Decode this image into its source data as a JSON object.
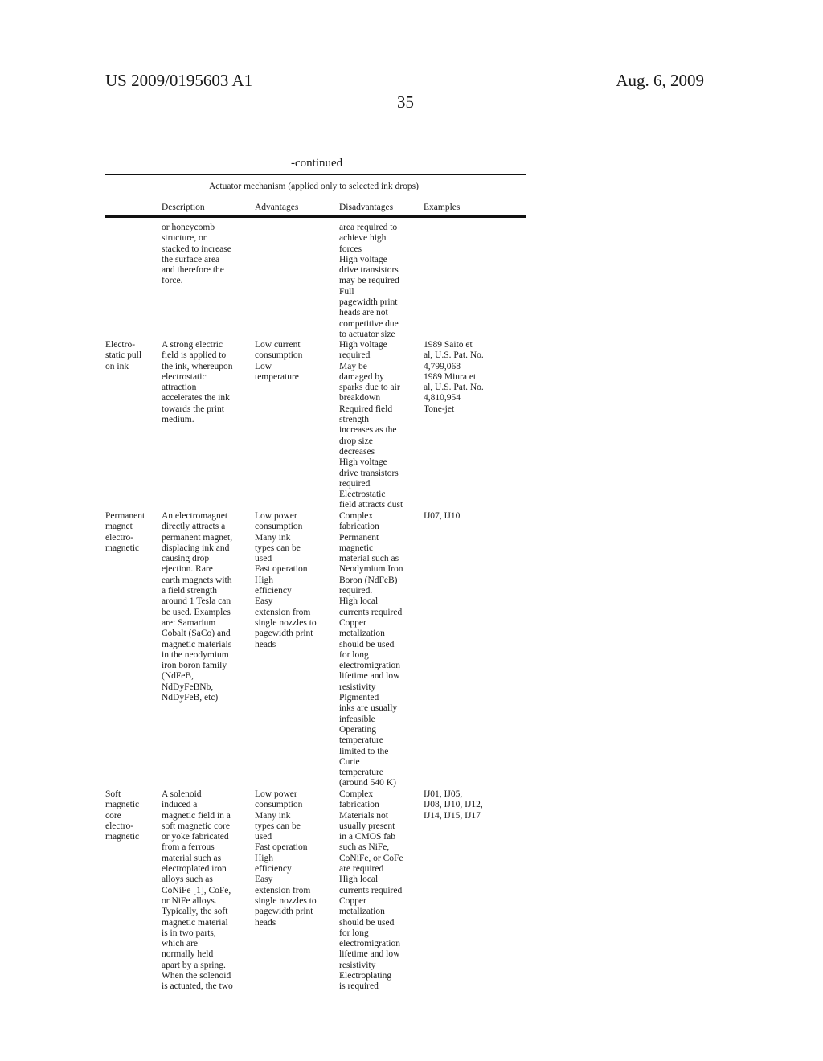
{
  "header": {
    "publication_number": "US 2009/0195603 A1",
    "date": "Aug. 6, 2009",
    "page_number": "35"
  },
  "table": {
    "continued_label": "-continued",
    "caption": "Actuator mechanism (applied only to selected ink drops)",
    "columns": [
      "",
      "Description",
      "Advantages",
      "Disadvantages",
      "Examples"
    ],
    "rows": [
      {
        "name": "",
        "description": "or honeycomb\nstructure, or\nstacked to increase\nthe surface area\nand therefore the\nforce.",
        "advantages": "",
        "disadvantages": "area required to\nachieve high\nforces\nHigh voltage\ndrive transistors\nmay be required\nFull\npagewidth print\nheads are not\ncompetitive due\nto actuator size",
        "examples": ""
      },
      {
        "name": "Electro-\nstatic pull\non ink",
        "description": "A strong electric\nfield is applied to\nthe ink, whereupon\nelectrostatic\nattraction\naccelerates the ink\ntowards the print\nmedium.",
        "advantages": "Low current\nconsumption\nLow\ntemperature",
        "disadvantages": "High voltage\nrequired\nMay be\ndamaged by\nsparks due to air\nbreakdown\nRequired field\nstrength\nincreases as the\ndrop size\ndecreases\nHigh voltage\ndrive transistors\nrequired\nElectrostatic\nfield attracts dust",
        "examples": "1989 Saito et\nal, U.S. Pat. No.\n4,799,068\n1989 Miura et\nal, U.S. Pat. No.\n4,810,954\nTone-jet"
      },
      {
        "name": "Permanent\nmagnet\nelectro-\nmagnetic",
        "description": "An electromagnet\ndirectly attracts a\npermanent magnet,\ndisplacing ink and\ncausing drop\nejection. Rare\nearth magnets with\na field strength\naround 1 Tesla can\nbe used. Examples\nare: Samarium\nCobalt (SaCo) and\nmagnetic materials\nin the neodymium\niron boron family\n(NdFeB,\nNdDyFeBNb,\nNdDyFeB, etc)",
        "advantages": "Low power\nconsumption\nMany ink\ntypes can be\nused\nFast operation\nHigh\nefficiency\nEasy\nextension from\nsingle nozzles to\npagewidth print\nheads",
        "disadvantages": "Complex\nfabrication\nPermanent\nmagnetic\nmaterial such as\nNeodymium Iron\nBoron (NdFeB)\nrequired.\nHigh local\ncurrents required\nCopper\nmetalization\nshould be used\nfor long\nelectromigration\nlifetime and low\nresistivity\nPigmented\ninks are usually\ninfeasible\nOperating\ntemperature\nlimited to the\nCurie\ntemperature\n(around 540 K)",
        "examples": "IJ07, IJ10"
      },
      {
        "name": "Soft\nmagnetic\ncore\nelectro-\nmagnetic",
        "description": "A solenoid\ninduced a\nmagnetic field in a\nsoft magnetic core\nor yoke fabricated\nfrom a ferrous\nmaterial such as\nelectroplated iron\nalloys such as\nCoNiFe [1], CoFe,\nor NiFe alloys.\nTypically, the soft\nmagnetic material\nis in two parts,\nwhich are\nnormally held\napart by a spring.\nWhen the solenoid\nis actuated, the two",
        "advantages": "Low power\nconsumption\nMany ink\ntypes can be\nused\nFast operation\nHigh\nefficiency\nEasy\nextension from\nsingle nozzles to\npagewidth print\nheads",
        "disadvantages": "Complex\nfabrication\nMaterials not\nusually present\nin a CMOS fab\nsuch as NiFe,\nCoNiFe, or CoFe\nare required\nHigh local\ncurrents required\nCopper\nmetalization\nshould be used\nfor long\nelectromigration\nlifetime and low\nresistivity\nElectroplating\nis required",
        "examples": "IJ01, IJ05,\nIJ08, IJ10, IJ12,\nIJ14, IJ15, IJ17"
      }
    ]
  }
}
